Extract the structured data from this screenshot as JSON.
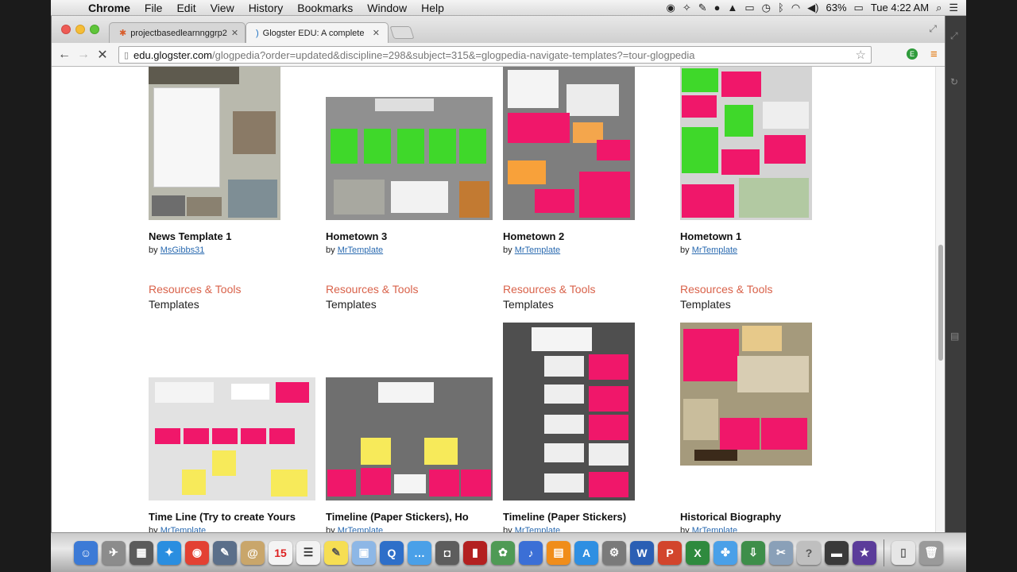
{
  "menubar": {
    "app_name": "Chrome",
    "items": [
      "File",
      "Edit",
      "View",
      "History",
      "Bookmarks",
      "Window",
      "Help"
    ],
    "battery": "63%",
    "clock": "Tue 4:22 AM"
  },
  "browser": {
    "tabs": [
      {
        "title": "projectbasedlearnnggrp2",
        "active": false
      },
      {
        "title": "Glogster EDU: A complete",
        "active": true
      }
    ],
    "url_host": "edu.glogster.com",
    "url_path": "/glogpedia?order=updated&discipline=298&subject=315&=glogpedia-navigate-templates?=tour-glogpedia"
  },
  "page": {
    "row1": [
      {
        "title": "News Template 1",
        "by": "by",
        "author": "MsGibbs31",
        "category": "Resources & Tools",
        "subcategory": "Templates"
      },
      {
        "title": "Hometown 3",
        "by": "by",
        "author": "MrTemplate",
        "category": "Resources & Tools",
        "subcategory": "Templates"
      },
      {
        "title": "Hometown 2",
        "by": "by",
        "author": "MrTemplate",
        "category": "Resources & Tools",
        "subcategory": "Templates"
      },
      {
        "title": "Hometown 1",
        "by": "by",
        "author": "MrTemplate",
        "category": "Resources & Tools",
        "subcategory": "Templates"
      }
    ],
    "row2": [
      {
        "title": "Time Line (Try to create Yours",
        "by": "by",
        "author": "MrTemplate"
      },
      {
        "title": "Timeline (Paper Stickers), Ho",
        "by": "by",
        "author": "MrTemplate"
      },
      {
        "title": "Timeline (Paper Stickers)",
        "by": "by",
        "author": "MrTemplate"
      },
      {
        "title": "Historical Biography",
        "by": "by",
        "author": "MrTemplate"
      }
    ]
  },
  "colors": {
    "category_link": "#d9624a",
    "author_link": "#2a6ab0",
    "glog_pink": "#f0176a",
    "glog_green": "#3fd82a",
    "glog_yellow": "#f7ea5a"
  }
}
